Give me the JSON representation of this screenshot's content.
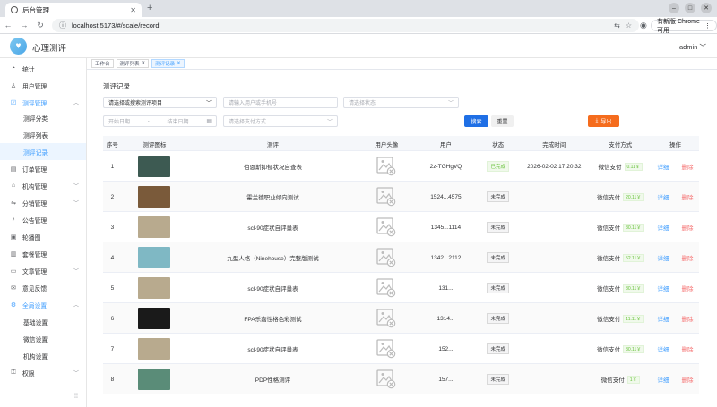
{
  "browser": {
    "tab_title": "后台管理",
    "url": "localhost:5173/#/scale/record",
    "update_label": "有新版 Chrome 可用"
  },
  "app": {
    "brand": "心理测评",
    "user": "admin"
  },
  "sidebar": {
    "items": [
      {
        "label": "统计",
        "icon": "chart-icon",
        "chev": ""
      },
      {
        "label": "用户管理",
        "icon": "user-icon",
        "chev": ""
      },
      {
        "label": "测评管理",
        "icon": "task-icon",
        "chev": "︿"
      },
      {
        "label": "测评分类",
        "sub": true
      },
      {
        "label": "测评列表",
        "sub": true
      },
      {
        "label": "测评记录",
        "sub": true
      },
      {
        "label": "订单管理",
        "icon": "order-icon",
        "chev": ""
      },
      {
        "label": "机构管理",
        "icon": "org-icon",
        "chev": "﹀"
      },
      {
        "label": "分销管理",
        "icon": "share-icon",
        "chev": "﹀"
      },
      {
        "label": "公告管理",
        "icon": "bell-icon",
        "chev": ""
      },
      {
        "label": "轮播图",
        "icon": "image-icon",
        "chev": ""
      },
      {
        "label": "套餐管理",
        "icon": "package-icon",
        "chev": ""
      },
      {
        "label": "文章管理",
        "icon": "doc-icon",
        "chev": "﹀"
      },
      {
        "label": "意见反馈",
        "icon": "feedback-icon",
        "chev": ""
      },
      {
        "label": "全局设置",
        "icon": "gear-icon",
        "chev": "︿"
      },
      {
        "label": "基础设置",
        "sub": true
      },
      {
        "label": "微信设置",
        "sub": true
      },
      {
        "label": "机构设置",
        "sub": true
      },
      {
        "label": "权限",
        "icon": "lock-icon",
        "chev": "﹀"
      }
    ]
  },
  "tags": [
    "工作台",
    "测评列表",
    "测评记录"
  ],
  "page": {
    "title": "测评记录"
  },
  "filters": {
    "scale": "请选择或搜索测评项目",
    "user": "请输入用户或手机号",
    "status": "请选择状态",
    "start": "开始日期",
    "sep": "-",
    "end": "结束日期",
    "pay": "请选择支付方式",
    "search": "搜索",
    "reset": "重置",
    "export": "导出"
  },
  "table": {
    "headers": [
      "序号",
      "测评图标",
      "测评",
      "用户头像",
      "用户",
      "状态",
      "完成时间",
      "支付方式",
      "操作"
    ],
    "rows": [
      {
        "idx": "1",
        "thumb": "#3d5a52",
        "name": "伯恩斯抑郁状况自查表",
        "user": "2z-TGHgVQ",
        "status": "已完成",
        "ok": true,
        "time": "2026-02-02 17:20:32",
        "pay": "微信支付",
        "amt": "0.11￥"
      },
      {
        "idx": "2",
        "thumb": "#7a5a3a",
        "name": "霍兰德职业倾向测试",
        "user": "1524...4575",
        "status": "未完成",
        "ok": false,
        "time": "",
        "pay": "微信支付",
        "amt": "20.11￥"
      },
      {
        "idx": "3",
        "thumb": "#b8aa8e",
        "name": "scl-90症状自评量表",
        "user": "1345...1114",
        "status": "未完成",
        "ok": false,
        "time": "",
        "pay": "微信支付",
        "amt": "30.11￥"
      },
      {
        "idx": "4",
        "thumb": "#7fb8c4",
        "name": "九型人格（Ninehouse）完整版测试",
        "user": "1342...2112",
        "status": "未完成",
        "ok": false,
        "time": "",
        "pay": "微信支付",
        "amt": "52.11￥"
      },
      {
        "idx": "5",
        "thumb": "#b8aa8e",
        "name": "scl-90症状自评量表",
        "user": "131...",
        "status": "未完成",
        "ok": false,
        "time": "",
        "pay": "微信支付",
        "amt": "30.11￥"
      },
      {
        "idx": "6",
        "thumb": "#1a1a1a",
        "name": "FPA乐嘉性格色彩测试",
        "user": "1314...",
        "status": "未完成",
        "ok": false,
        "time": "",
        "pay": "微信支付",
        "amt": "11.11￥"
      },
      {
        "idx": "7",
        "thumb": "#b8aa8e",
        "name": "scl-90症状自评量表",
        "user": "152...",
        "status": "未完成",
        "ok": false,
        "time": "",
        "pay": "微信支付",
        "amt": "30.11￥"
      },
      {
        "idx": "8",
        "thumb": "#5a8c78",
        "name": "PDP性格测评",
        "user": "157...",
        "status": "未完成",
        "ok": false,
        "time": "",
        "pay": "微信支付",
        "amt": "1￥"
      }
    ],
    "detail": "详细",
    "delete": "删除"
  },
  "colors": {
    "primary": "#409eff",
    "search": "#1f6fe5",
    "export": "#f56c1d",
    "danger": "#f56c6c",
    "success": "#67c23a"
  }
}
